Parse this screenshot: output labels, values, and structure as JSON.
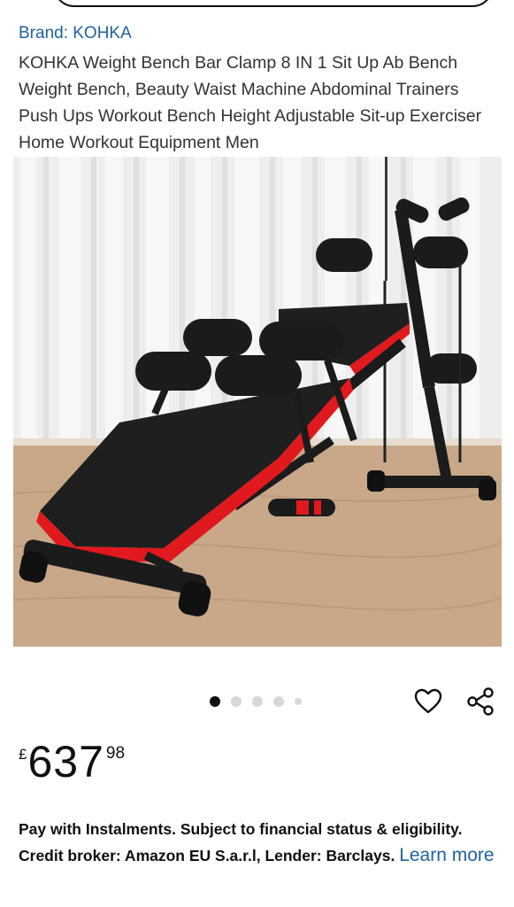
{
  "product": {
    "brand_label": "Brand: KOHKA",
    "title": "KOHKA Weight Bench Bar Clamp 8 IN 1 Sit Up Ab Bench Weight Bench, Beauty Waist Machine Abdominal Trainers Push Ups Workout Bench Height Adjustable Sit-up Exerciser Home Workout Equipment Men"
  },
  "gallery": {
    "image_count": 5,
    "active_index": 0
  },
  "icons": {
    "wishlist": "heart-icon",
    "share": "share-icon"
  },
  "price": {
    "currency_symbol": "£",
    "whole": "637",
    "fraction": "98"
  },
  "instalments": {
    "text": "Pay with Instalments. Subject to financial status & eligibility. Credit broker: Amazon EU S.a.r.l, Lender: Barclays.",
    "link_label": "Learn more"
  },
  "colors": {
    "link": "#2162a1",
    "bench_red": "#e0191e",
    "pad_black": "#1b1b1b"
  }
}
